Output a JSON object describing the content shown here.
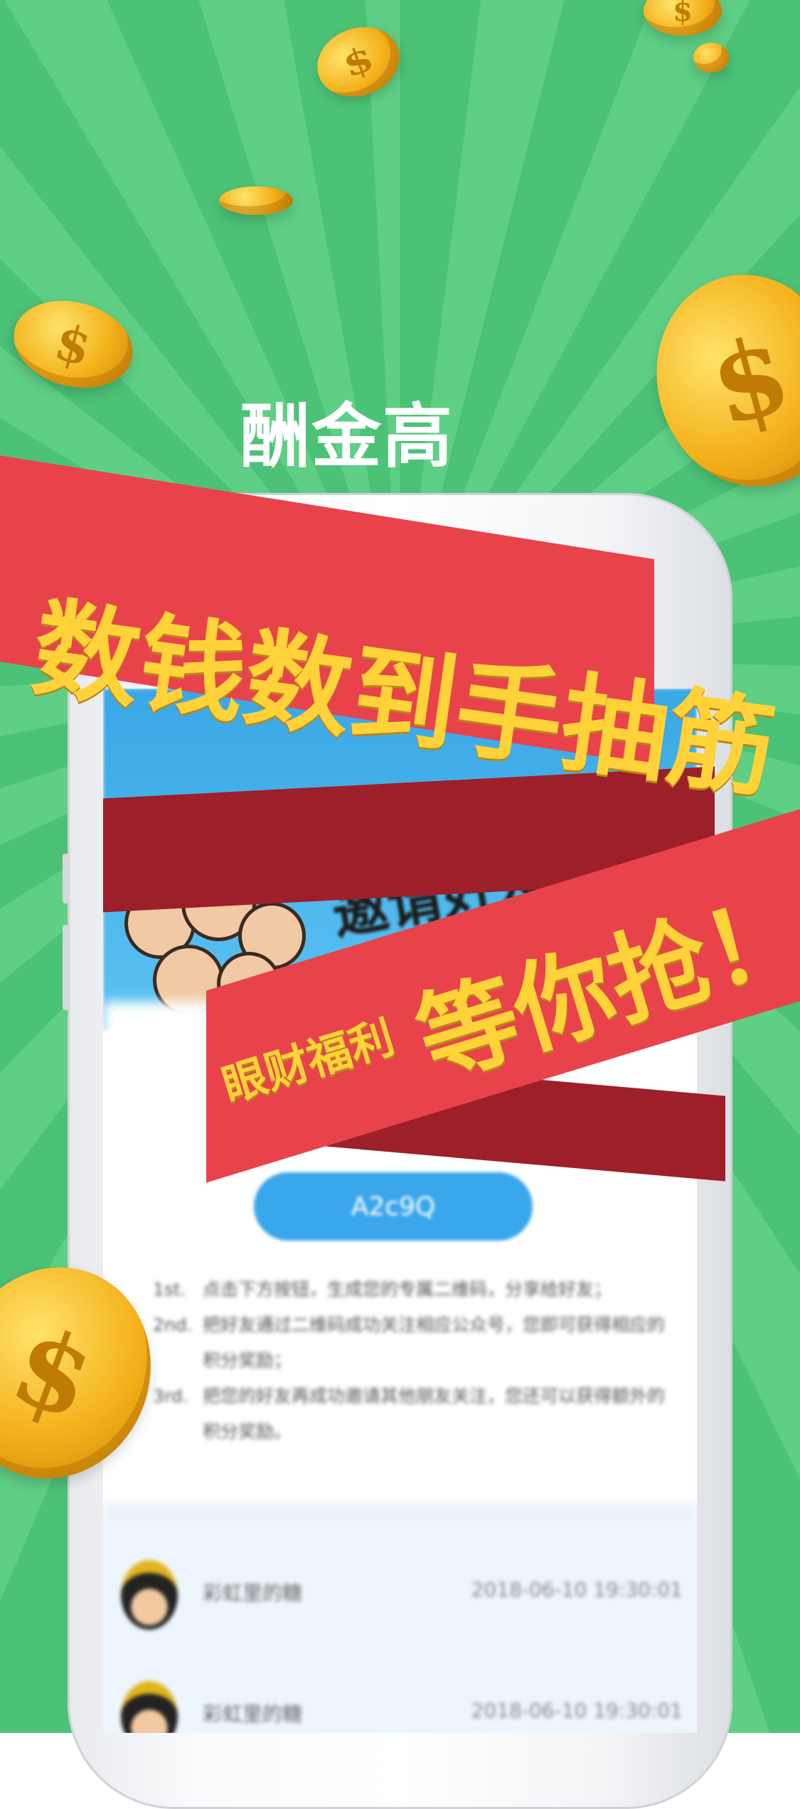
{
  "logo": {
    "text": "酬金高"
  },
  "banner_top": {
    "text": "数钱数到手抽筋"
  },
  "banner_bottom": {
    "small_text": "眼财福利",
    "big_text": "等你抢！"
  },
  "screen": {
    "invite_title": "邀请好友",
    "invite_code": "A2c9Q",
    "steps": [
      {
        "num": "1st.",
        "text": "点击下方按钮，生成您的专属二维码，分享给好友；"
      },
      {
        "num": "2nd.",
        "text": "把好友通过二维码成功关注相应公众号，您即可获得相应的积分奖励；"
      },
      {
        "num": "3rd.",
        "text": "把您的好友再成功邀请其他朋友关注，您还可以获得额外的积分奖励。"
      }
    ],
    "list": [
      {
        "name": "彩虹里的糖",
        "time": "2018-06-10 19:30:01"
      },
      {
        "name": "彩虹里的糖",
        "time": "2018-06-10 19:30:01"
      }
    ]
  },
  "colors": {
    "background": "#4cc277",
    "banner": "#e8434b",
    "banner_text": "#ffd23a",
    "pill": "#3aa6ec"
  },
  "icons": {
    "coin": "dollar-coin-icon"
  }
}
